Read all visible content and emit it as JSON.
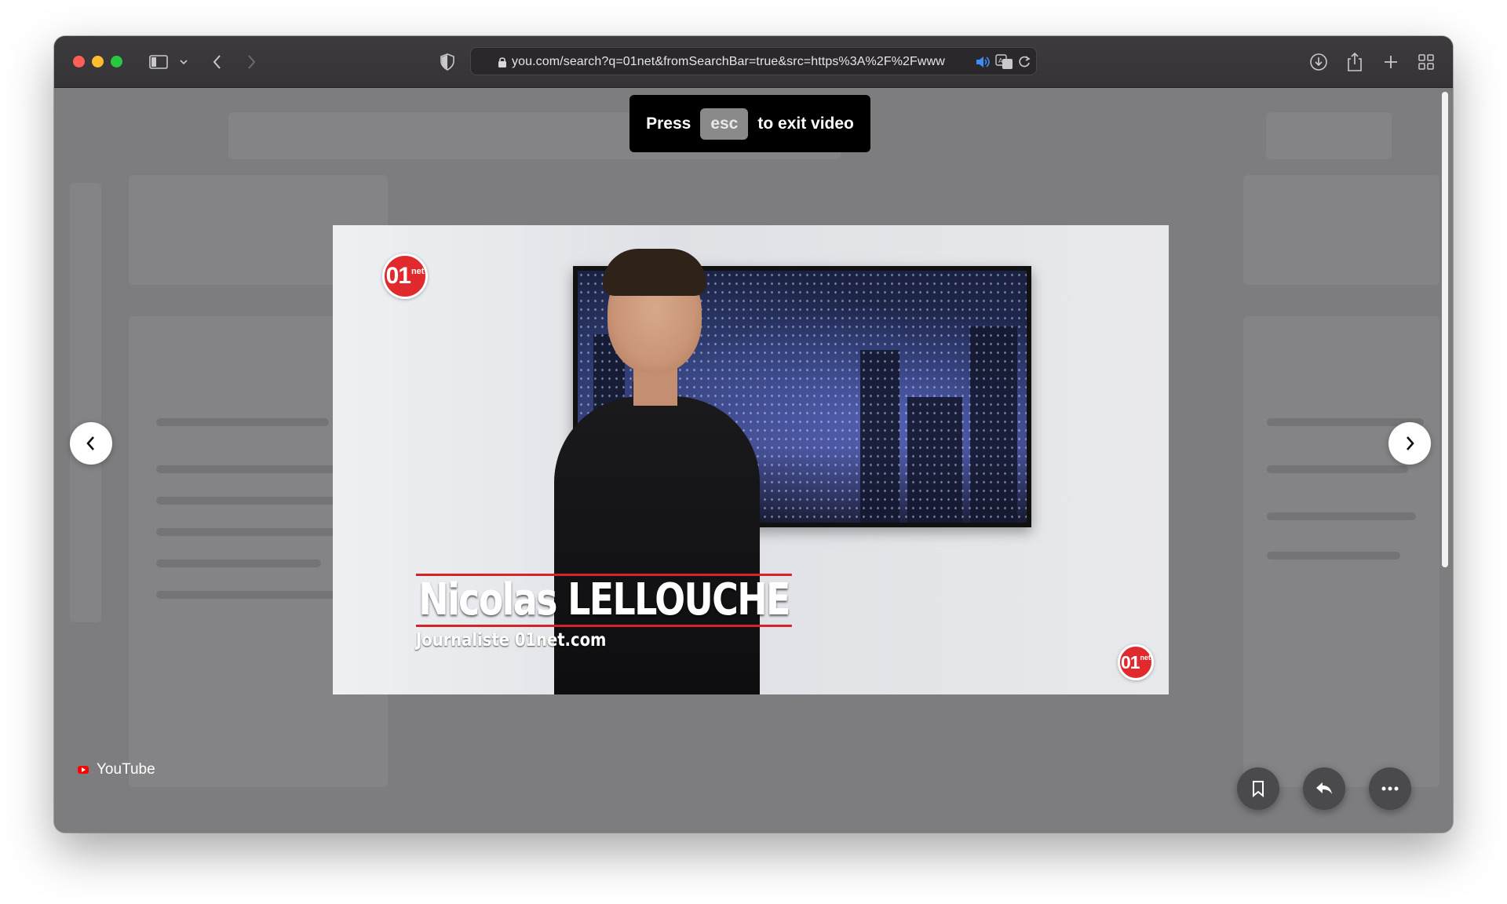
{
  "browser": {
    "url": "you.com/search?q=01net&fromSearchBar=true&src=https%3A%2F%2Fwww",
    "icons": {
      "sidebar": "sidebar-icon",
      "back": "chevron-left-icon",
      "forward": "chevron-right-icon",
      "shield": "shield-icon",
      "lock": "lock-icon",
      "audio": "speaker-icon",
      "translate": "translate-icon",
      "reload": "reload-icon",
      "downloads": "download-icon",
      "share": "share-icon",
      "new_tab": "plus-icon",
      "tab_overview": "grid-icon"
    }
  },
  "overlay": {
    "press": "Press",
    "key": "esc",
    "exit": "to exit video"
  },
  "video": {
    "logo_number": "01",
    "logo_suffix": "net",
    "name": "Nicolas LELLOUCHE",
    "role": "Journaliste 01net.com"
  },
  "footer": {
    "source": "YouTube"
  },
  "colors": {
    "brand_red": "#e02a2d",
    "youtube_red": "#ff0000"
  }
}
